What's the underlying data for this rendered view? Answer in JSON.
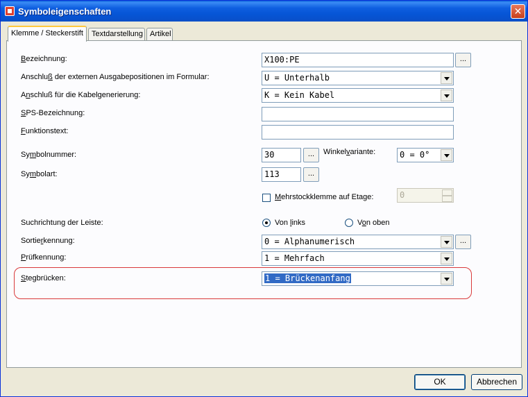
{
  "window": {
    "title": "Symboleigenschaften",
    "close_label": "✕"
  },
  "tabs": [
    "Klemme / Steckerstift",
    "Textdarstellung",
    "Artikel"
  ],
  "fields": {
    "bezeichnung": {
      "label_pre": "",
      "label_key": "B",
      "label_post": "ezeichnung:",
      "value": "X100:PE",
      "button": "..."
    },
    "anschluss_formular": {
      "label_pre": "Anschlu",
      "label_key": "ß",
      "label_post": " der externen Ausgabepositionen im Formular:",
      "value": "U = Unterhalb"
    },
    "anschluss_kabel": {
      "label_pre": "A",
      "label_key": "n",
      "label_post": "schluß für die Kabelgenerierung:",
      "value": "K = Kein Kabel"
    },
    "sps_bezeichnung": {
      "label_pre": "",
      "label_key": "S",
      "label_post": "PS-Bezeichnung:",
      "value": ""
    },
    "funktionstext": {
      "label_pre": "",
      "label_key": "F",
      "label_post": "unktionstext:",
      "value": ""
    },
    "symbolnummer": {
      "label_pre": "Sy",
      "label_key": "m",
      "label_post": "bolnummer:",
      "value": "30",
      "button": "..."
    },
    "winkelvariante": {
      "label_pre": "Winkel",
      "label_key": "v",
      "label_post": "ariante:",
      "value": "0 = 0°"
    },
    "symbolart": {
      "label_pre": "Sy",
      "label_key": "m",
      "label_post": "bolart:",
      "value": "113",
      "button": "..."
    },
    "mehrstock": {
      "label_pre": "",
      "label_key": "M",
      "label_post": "ehrstockklemme auf Etage:",
      "checked": false,
      "spin_value": "0"
    },
    "suchrichtung": {
      "label": "Suchrichtung der Leiste:",
      "option1": {
        "pre": "Von ",
        "key": "l",
        "post": "inks",
        "selected": true
      },
      "option2": {
        "pre": "V",
        "key": "o",
        "post": "n oben",
        "selected": false
      }
    },
    "sortierkennung": {
      "label_pre": "Sortie",
      "label_key": "r",
      "label_post": "kennung:",
      "value": "0 = Alphanumerisch",
      "button": "..."
    },
    "pruefkennung": {
      "label_pre": "",
      "label_key": "P",
      "label_post": "rüfkennung:",
      "value": "1 = Mehrfach"
    },
    "stegbruecken": {
      "label_pre": "",
      "label_key": "S",
      "label_post": "tegbrücken:",
      "value": "1 = Brückenanfang"
    }
  },
  "buttons": {
    "ok": "OK",
    "cancel": "Abbrechen"
  }
}
